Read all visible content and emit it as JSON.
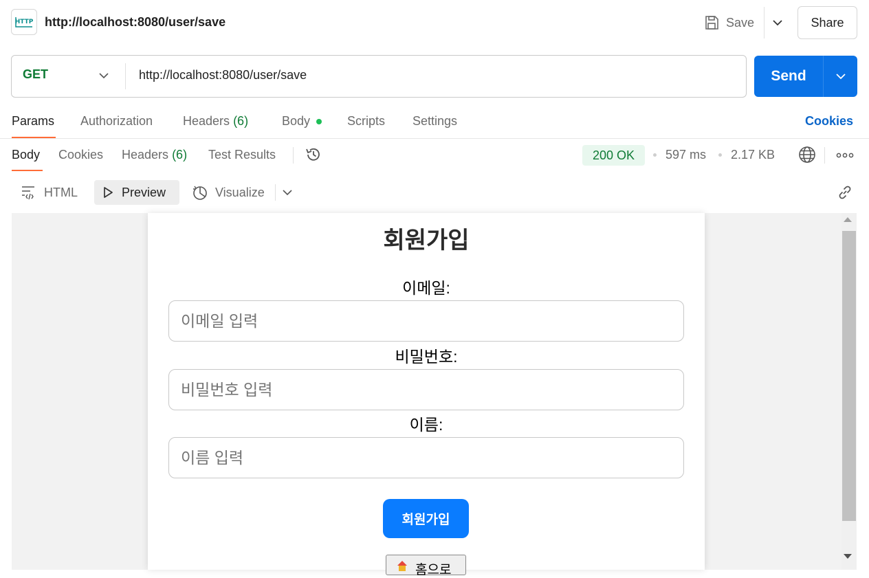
{
  "request": {
    "title": "http://localhost:8080/user/save",
    "icon": "http-request-icon",
    "icon_label": "HTTP",
    "save_label": "Save",
    "share_label": "Share"
  },
  "url_bar": {
    "method": "GET",
    "url": "http://localhost:8080/user/save",
    "send_label": "Send"
  },
  "request_tabs": {
    "params": "Params",
    "authorization": "Authorization",
    "headers": "Headers",
    "headers_count": "(6)",
    "body": "Body",
    "scripts": "Scripts",
    "settings": "Settings",
    "cookies": "Cookies"
  },
  "response_tabs": {
    "body": "Body",
    "cookies": "Cookies",
    "headers": "Headers",
    "headers_count": "(6)",
    "test_results": "Test Results",
    "status": "200 OK",
    "time": "597 ms",
    "size": "2.17 KB"
  },
  "view_toolbar": {
    "html": "HTML",
    "preview": "Preview",
    "visualize": "Visualize"
  },
  "form": {
    "title": "회원가입",
    "email_label": "이메일:",
    "email_placeholder": "이메일 입력",
    "password_label": "비밀번호:",
    "password_placeholder": "비밀번호 입력",
    "name_label": "이름:",
    "name_placeholder": "이름 입력",
    "submit_label": "회원가입",
    "home_label": "홈으로"
  },
  "colors": {
    "accent": "#0a72e6",
    "tab_underline": "#ff6c37",
    "success": "#0f7b35",
    "submit": "#0a7cff"
  }
}
